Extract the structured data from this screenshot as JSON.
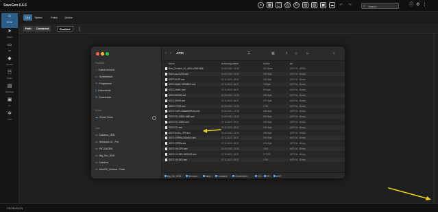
{
  "app": {
    "title": "SaveGen 6.6.6"
  },
  "topbar": {
    "icons": [
      "search-icon",
      "grid-icon",
      "square-icon",
      "globe-icon",
      "refresh-icon",
      "folder-icon",
      "image-icon",
      "save-icon",
      "cloud-icon",
      "undo-icon",
      "redo-icon"
    ],
    "search_placeholder": "Search",
    "right_icons": [
      "info-icon",
      "gear-icon",
      "more-icon"
    ]
  },
  "rail": {
    "items": [
      {
        "label": "Home",
        "icon": "house-icon"
      },
      {
        "label": "Saves",
        "icon": "send-icon"
      },
      {
        "label": "SP",
        "icon": "monitor-icon"
      },
      {
        "label": "Cheats",
        "icon": "diamond-icon"
      },
      {
        "label": "Mods",
        "icon": "people-icon"
      },
      {
        "label": "Windows",
        "icon": "server-icon"
      },
      {
        "label": "IC",
        "icon": "box-icon"
      },
      {
        "label": "LAN",
        "icon": "gear-icon"
      }
    ]
  },
  "menubar": {
    "items": [
      "GUI",
      "Tables",
      "Patch",
      "Quirks"
    ],
    "active_index": 0
  },
  "toolbar": {
    "buttons": [
      "Path",
      "Comment",
      "Enabled"
    ]
  },
  "finder": {
    "folder": "ACPI",
    "sidebar": {
      "favorites_header": "Favorites",
      "favorites": [
        "Zuletzt benutzt",
        "Schreibtisch",
        "Programme",
        "Dokumente",
        "Downloads"
      ],
      "icloud_header": "iCloud",
      "icloud": [
        "iCloud Drive"
      ],
      "locations_header": "Orte",
      "locations": [
        "Catalina_HDD",
        "Windows 10 - Pro",
        "PAT-DATEN",
        "Big_Sur_HDD",
        "Catalina",
        "MacOS_Ventura - Data"
      ]
    },
    "columns": {
      "name": "Name",
      "date": "Änderungsdatum",
      "size": "Größe",
      "kind": "Art"
    },
    "files": [
      {
        "name": "Bios_Cominis_V1_v650-L0090-B06",
        "date": "01.09.2022, 14:30",
        "size": "411 Bytes",
        "kind": "ACPI M…ARE6"
      },
      {
        "name": "SSDT-ALC1200.aml",
        "date": "01.09.2022, 14:30",
        "size": "203 Byte",
        "kind": "ACPI M…Binary"
      },
      {
        "name": "SSDT-ALS0.aml",
        "date": "07.11.2022, 18:37",
        "size": "118 Byte",
        "kind": "ACPI M…Binary"
      },
      {
        "name": "SSDT-AWAC-DISABLE.aml",
        "date": "07.11.2022, 18:37",
        "size": "78 Byte",
        "kind": "ACPI M…Binary"
      },
      {
        "name": "SSDT-AWAC.aml",
        "date": "07.11.2022, 18:37",
        "size": "99 Byte",
        "kind": "ACPI M…Binary"
      },
      {
        "name": "SSDT-BOOM.aml",
        "date": "01.09.2022, 14:30",
        "size": "398 Byte",
        "kind": "ACPI M…Binary"
      },
      {
        "name": "SSDT-BRG0.aml",
        "date": "07.11.2022, 18:37",
        "size": "127 Byte",
        "kind": "ACPI M…Binary"
      },
      {
        "name": "SSDT-CPUR.aml",
        "date": "01.09.2022, 14:30",
        "size": "2 KB",
        "kind": "ACPI M…Binary"
      },
      {
        "name": "SSDT-DGPU-Disable6Ruby.aml",
        "date": "01.09.2022, 17:18",
        "size": "338 Byte",
        "kind": "ACPI M…Binary"
      },
      {
        "name": "SSDT-EC-USBX-AMD.aml",
        "date": "01.09.2022, 14:30",
        "size": "523 Byte",
        "kind": "ACPI M…Binary"
      },
      {
        "name": "SSDT-EC-USBX.aml",
        "date": "07.11.2022, 18:37",
        "size": "334 Byte",
        "kind": "ACPI M…Binary"
      },
      {
        "name": "SSDT-EC.aml",
        "date": "07.11.2022, 18:37",
        "size": "145 Byte",
        "kind": "ACPI M…Binary"
      },
      {
        "name": "SSDT-EHCx_OFF.aml",
        "date": "01.09.2022, 14:30",
        "size": "159 Byte",
        "kind": "ACPI M…Binary"
      },
      {
        "name": "SSDT-GPRW-DISABLE.aml",
        "date": "07.11.2022, 18:37",
        "size": "104 Byte",
        "kind": "ACPI M…Binary"
      },
      {
        "name": "SSDT-GPRW.aml",
        "date": "07.11.2022, 18:37",
        "size": "151 Byte",
        "kind": "ACPI M…Binary"
      },
      {
        "name": "SSDT-HV-CPU.aml",
        "date": "01.09.2022, 14:30",
        "size": "2 KB",
        "kind": "ACPI M…Binary"
      },
      {
        "name": "SSDT-HV-DEV-WS2022.aml",
        "date": "07.11.2022, 18:37",
        "size": "157 KB",
        "kind": "ACPI M…Binary"
      },
      {
        "name": "SSDT-HV-DEV.aml",
        "date": "07.11.2022, 18:37",
        "size": "2 KB",
        "kind": "ACPI M…Binary"
      }
    ],
    "pathbar": [
      "Big_Sur_HDD",
      "Benutzer",
      "Valdo",
      "Laufwerk",
      "Schreibtisch",
      "OC",
      "EFI",
      "ACPI"
    ]
  },
  "statusbar": {
    "text": "PROBATION"
  },
  "colors": {
    "accent": "#2b5e86",
    "annotation": "#f1d21b"
  }
}
